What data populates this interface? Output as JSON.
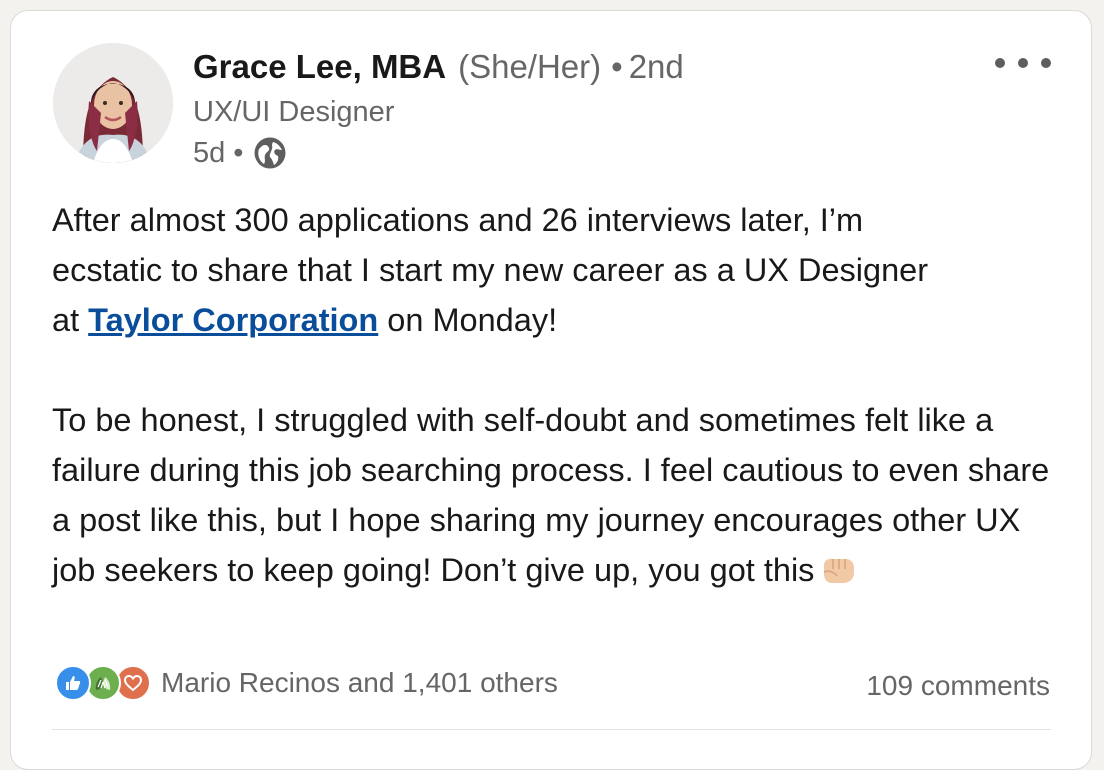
{
  "author": {
    "name": "Grace Lee, MBA",
    "pronouns": "(She/Her)",
    "separator": "•",
    "connection_degree": "2nd",
    "headline": "UX/UI Designer",
    "time_ago": "5d",
    "meta_separator": "•",
    "visibility_icon": "globe-icon"
  },
  "post": {
    "line1": "After almost 300 applications and 26 interviews later, I’m",
    "line2": "ecstatic to share that I start my new career as a UX Designer",
    "line3_prefix": "at ",
    "mention": "Taylor Corporation",
    "line3_suffix": " on Monday!",
    "paragraph2": "To be honest, I struggled with self-doubt and sometimes felt like a failure during this job searching process. I feel cautious to even share a post like this, but I hope sharing my journey encourages other UX job seekers to keep going! Don’t give up, you got this",
    "emoji_icon": "fist-bump-icon"
  },
  "social": {
    "reaction_icons": [
      "like-icon",
      "celebrate-icon",
      "love-icon"
    ],
    "reactions_text": "Mario Recinos and 1,401 others",
    "comments_text": "109 comments"
  },
  "colors": {
    "link": "#0a4e9b",
    "like": "#378fe9",
    "celebrate": "#44712e",
    "love": "#df704d"
  }
}
